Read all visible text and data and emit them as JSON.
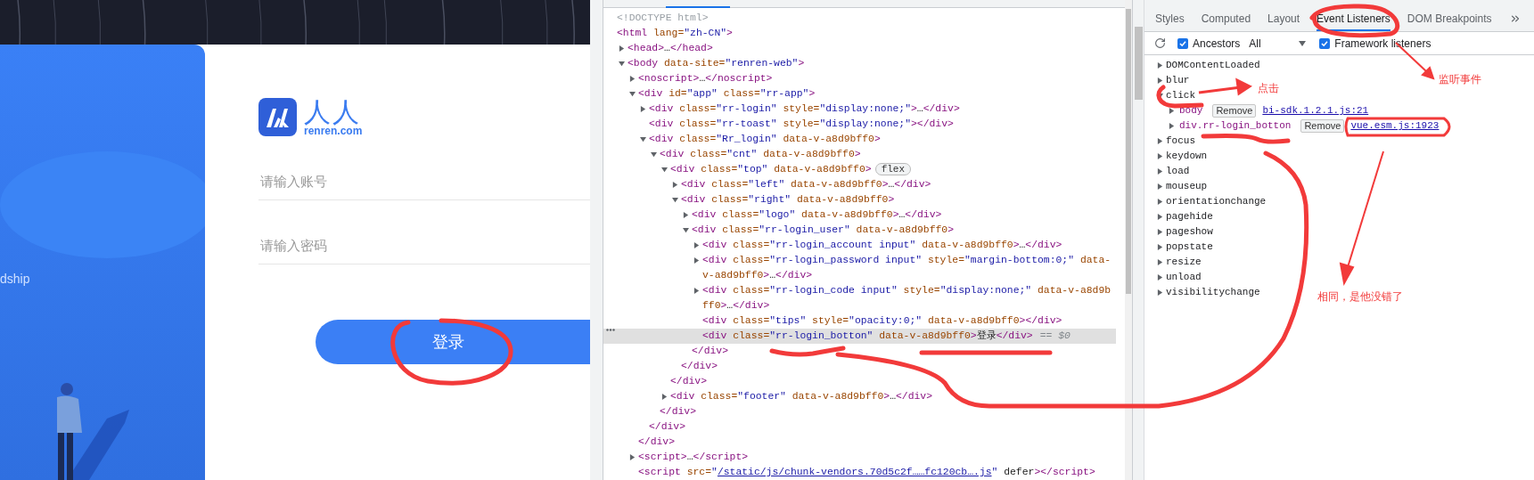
{
  "login_page": {
    "side_text": "dship",
    "logo": {
      "name": "人人",
      "domain": "renren.com"
    },
    "fields": [
      {
        "placeholder": "请输入账号"
      },
      {
        "placeholder": "请输入密码"
      }
    ],
    "login_button": "登录"
  },
  "elements": {
    "tree": [
      {
        "kind": "doctype",
        "text": "<!DOCTYPE html>",
        "selected": false
      },
      {
        "text": "<html lang=\"zh-CN\">",
        "selected": false,
        "children": [
          {
            "text": "<head>…</head>",
            "expanded": false,
            "selected": false
          },
          {
            "text": "<body data-site=\"renren-web\">",
            "expanded": true,
            "selected": false,
            "children": [
              {
                "text": "<noscript>…</noscript>",
                "expanded": false,
                "selected": false
              },
              {
                "text": "<div id=\"app\" class=\"rr-app\">",
                "expanded": true,
                "selected": false,
                "close": "</div>",
                "children": [
                  {
                    "text": "<div class=\"rr-login\" style=\"display:none;\">…</div>",
                    "expanded": false,
                    "selected": false
                  },
                  {
                    "text": "<div class=\"rr-toast\" style=\"display:none;\"></div>",
                    "selected": false
                  },
                  {
                    "text": "<div class=\"Rr_login\" data-v-a8d9bff0>",
                    "expanded": true,
                    "selected": false,
                    "close": "</div>",
                    "children": [
                      {
                        "text": "<div class=\"cnt\" data-v-a8d9bff0>",
                        "expanded": true,
                        "selected": false,
                        "close": "</div>",
                        "children": [
                          {
                            "text": "<div class=\"top\" data-v-a8d9bff0>",
                            "badge": "flex",
                            "expanded": true,
                            "selected": false,
                            "close": "</div>",
                            "children": [
                              {
                                "text": "<div class=\"left\" data-v-a8d9bff0>…</div>",
                                "expanded": false,
                                "selected": false
                              },
                              {
                                "text": "<div class=\"right\" data-v-a8d9bff0>",
                                "expanded": true,
                                "selected": false,
                                "close": "</div>",
                                "children": [
                                  {
                                    "text": "<div class=\"logo\" data-v-a8d9bff0>…</div>",
                                    "expanded": false,
                                    "selected": false
                                  },
                                  {
                                    "text": "<div class=\"rr-login_user\" data-v-a8d9bff0>",
                                    "expanded": true,
                                    "selected": false,
                                    "close": "</div>",
                                    "children": [
                                      {
                                        "text": "<div class=\"rr-login_account input\" data-v-a8d9bff0>…</div>",
                                        "expanded": false,
                                        "selected": false
                                      },
                                      {
                                        "text": "<div class=\"rr-login_password input\" style=\"margin-bottom:0;\" data-v-a8d9bff0>…</div>",
                                        "expanded": false,
                                        "selected": false
                                      },
                                      {
                                        "text": "<div class=\"rr-login_code input\" style=\"display:none;\" data-v-a8d9bff0>…</div>",
                                        "expanded": false,
                                        "selected": false
                                      },
                                      {
                                        "text": "<div class=\"tips\" style=\"opacity:0;\" data-v-a8d9bff0></div>",
                                        "selected": false
                                      },
                                      {
                                        "text": "<div class=\"rr-login_botton\" data-v-a8d9bff0>登录</div>",
                                        "selected": true,
                                        "suffix": "== $0"
                                      }
                                    ]
                                  }
                                ]
                              }
                            ]
                          },
                          {
                            "text": "<div class=\"footer\" data-v-a8d9bff0>…</div>",
                            "expanded": false,
                            "selected": false
                          }
                        ]
                      }
                    ]
                  }
                ]
              },
              {
                "text": "<script>…</script>",
                "expanded": false,
                "selected": false
              },
              {
                "text": "<script src=\"",
                "link": "/static/js/chunk-vendors.70d5c2f……fc120cb….js",
                "text_after": "\" defer></script>",
                "selected": false
              }
            ]
          }
        ]
      }
    ]
  },
  "sidebar": {
    "tabs": [
      {
        "label": "Styles",
        "selected": false
      },
      {
        "label": "Computed",
        "selected": false
      },
      {
        "label": "Layout",
        "selected": false
      },
      {
        "label": "Event Listeners",
        "selected": true
      },
      {
        "label": "DOM Breakpoints",
        "selected": false
      }
    ],
    "toolbar": {
      "ancestors": {
        "label": "Ancestors",
        "checked": true
      },
      "filter": "All",
      "framework": {
        "label": "Framework listeners",
        "checked": true
      }
    },
    "listeners": [
      {
        "event": "DOMContentLoaded",
        "expanded": false
      },
      {
        "event": "blur",
        "expanded": false
      },
      {
        "event": "click",
        "expanded": true,
        "children": [
          {
            "node": "body",
            "button": "Remove",
            "source": "bi-sdk.1.2.1.js:21",
            "expanded": false
          },
          {
            "node": "div.rr-login_botton",
            "button": "Remove",
            "source": "vue.esm.js:1923",
            "expanded": false
          }
        ]
      },
      {
        "event": "focus",
        "expanded": false
      },
      {
        "event": "keydown",
        "expanded": false
      },
      {
        "event": "load",
        "expanded": false
      },
      {
        "event": "mouseup",
        "expanded": false
      },
      {
        "event": "orientationchange",
        "expanded": false
      },
      {
        "event": "pagehide",
        "expanded": false
      },
      {
        "event": "pageshow",
        "expanded": false
      },
      {
        "event": "popstate",
        "expanded": false
      },
      {
        "event": "resize",
        "expanded": false
      },
      {
        "event": "unload",
        "expanded": false
      },
      {
        "event": "visibilitychange",
        "expanded": false
      }
    ]
  },
  "annotations": [
    {
      "text": "点击"
    },
    {
      "text": "监听事件"
    },
    {
      "text": "相同，是他没错了"
    }
  ]
}
